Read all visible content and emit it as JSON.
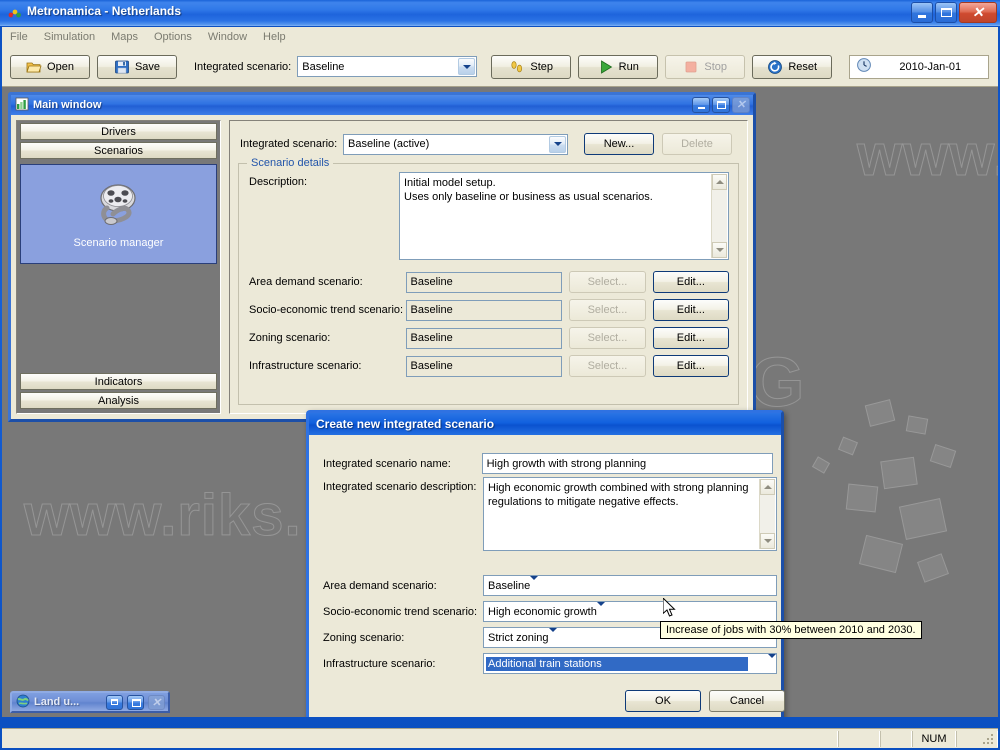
{
  "app": {
    "title_bold": "Metronamica",
    "title_rest": " - Netherlands",
    "icon": "metronamica-app-icon",
    "window_buttons": {
      "minimize": "_",
      "maximize": "□",
      "close": "✕"
    }
  },
  "menubar": {
    "items": [
      {
        "label": "File"
      },
      {
        "label": "Simulation"
      },
      {
        "label": "Maps"
      },
      {
        "label": "Options"
      },
      {
        "label": "Window"
      },
      {
        "label": "Help"
      }
    ]
  },
  "toolbar": {
    "open_label": "Open",
    "save_label": "Save",
    "scenario_label": "Integrated scenario:",
    "scenario_value": "Baseline",
    "step_label": "Step",
    "run_label": "Run",
    "stop_label": "Stop",
    "reset_label": "Reset",
    "date_value": "2010-Jan-01"
  },
  "desktop": {
    "watermark_left": "www.riks.",
    "watermark_right": "www.r"
  },
  "main_window": {
    "title": "Main window",
    "icon": "chart-window-icon",
    "buttons": {
      "minimize": "_",
      "maximize": "□",
      "close": "✕"
    },
    "sidebar": {
      "top_buttons": [
        {
          "label": "Drivers"
        },
        {
          "label": "Scenarios"
        }
      ],
      "active_tile": {
        "label": "Scenario manager",
        "icon": "film-reel-icon"
      },
      "bottom_buttons": [
        {
          "label": "Indicators"
        },
        {
          "label": "Analysis"
        }
      ]
    },
    "content": {
      "integrated_scenario_label": "Integrated scenario:",
      "integrated_scenario_value": "Baseline (active)",
      "new_button": "New...",
      "delete_button": "Delete",
      "group_title": "Scenario details",
      "description_label": "Description:",
      "description_value": "Initial model setup.\nUses only baseline or business as usual scenarios.",
      "rows": [
        {
          "label": "Area demand scenario:",
          "value": "Baseline",
          "select": "Select...",
          "edit": "Edit..."
        },
        {
          "label": "Socio-economic trend scenario:",
          "value": "Baseline",
          "select": "Select...",
          "edit": "Edit..."
        },
        {
          "label": "Zoning scenario:",
          "value": "Baseline",
          "select": "Select...",
          "edit": "Edit..."
        },
        {
          "label": "Infrastructure scenario:",
          "value": "Baseline",
          "select": "Select...",
          "edit": "Edit..."
        }
      ]
    }
  },
  "dialog": {
    "title": "Create new integrated scenario",
    "name_label": "Integrated scenario name:",
    "name_value": "High growth with strong planning",
    "description_label": "Integrated scenario description:",
    "description_value": "High economic growth combined with strong planning\nregulations to mitigate negative effects.",
    "rows": [
      {
        "label": "Area demand scenario:",
        "value": "Baseline",
        "selected": false
      },
      {
        "label": "Socio-economic trend scenario:",
        "value": "High economic growth",
        "selected": false
      },
      {
        "label": "Zoning scenario:",
        "value": "Strict zoning",
        "selected": false
      },
      {
        "label": "Infrastructure scenario:",
        "value": "Additional train stations",
        "selected": true
      }
    ],
    "ok_label": "OK",
    "cancel_label": "Cancel"
  },
  "tooltip": {
    "text": "Increase of jobs with 30% between 2010 and 2030."
  },
  "minimized_child": {
    "title": "Land u...",
    "icon": "globe-icon",
    "buttons": {
      "restore": "❐",
      "maximize": "□",
      "close": "✕"
    }
  },
  "statusbar": {
    "message": "",
    "cells": [
      "",
      "",
      "",
      "NUM",
      ""
    ]
  },
  "colors": {
    "titlebar_blue": "#1560d8",
    "face": "#ece9d8",
    "mdi_background": "#787878",
    "selection_blue": "#316ac5",
    "group_title": "#2255aa",
    "tile_blue": "#8aa0de",
    "tooltip_bg": "#ffffe1"
  }
}
